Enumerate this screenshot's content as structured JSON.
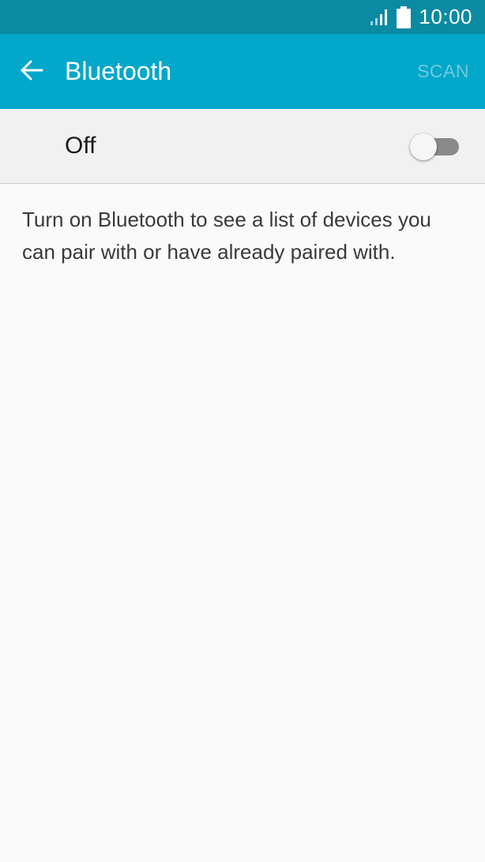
{
  "status_bar": {
    "time": "10:00",
    "icons": [
      "signal-icon",
      "battery-icon"
    ]
  },
  "app_bar": {
    "back_icon": "arrow-left-icon",
    "title": "Bluetooth",
    "scan_label": "SCAN"
  },
  "bluetooth_switch": {
    "label": "Off",
    "state": "off"
  },
  "info": {
    "text": "Turn on Bluetooth to see a list of devices you can pair with or have already paired with."
  },
  "colors": {
    "status_bar": "#0a8aa3",
    "app_bar": "#02a7c9",
    "scan_disabled": "#6fcadd",
    "switch_row_bg": "#f1f1f1",
    "toggle_track_off": "#8a8a8a",
    "background": "#fafafa"
  }
}
